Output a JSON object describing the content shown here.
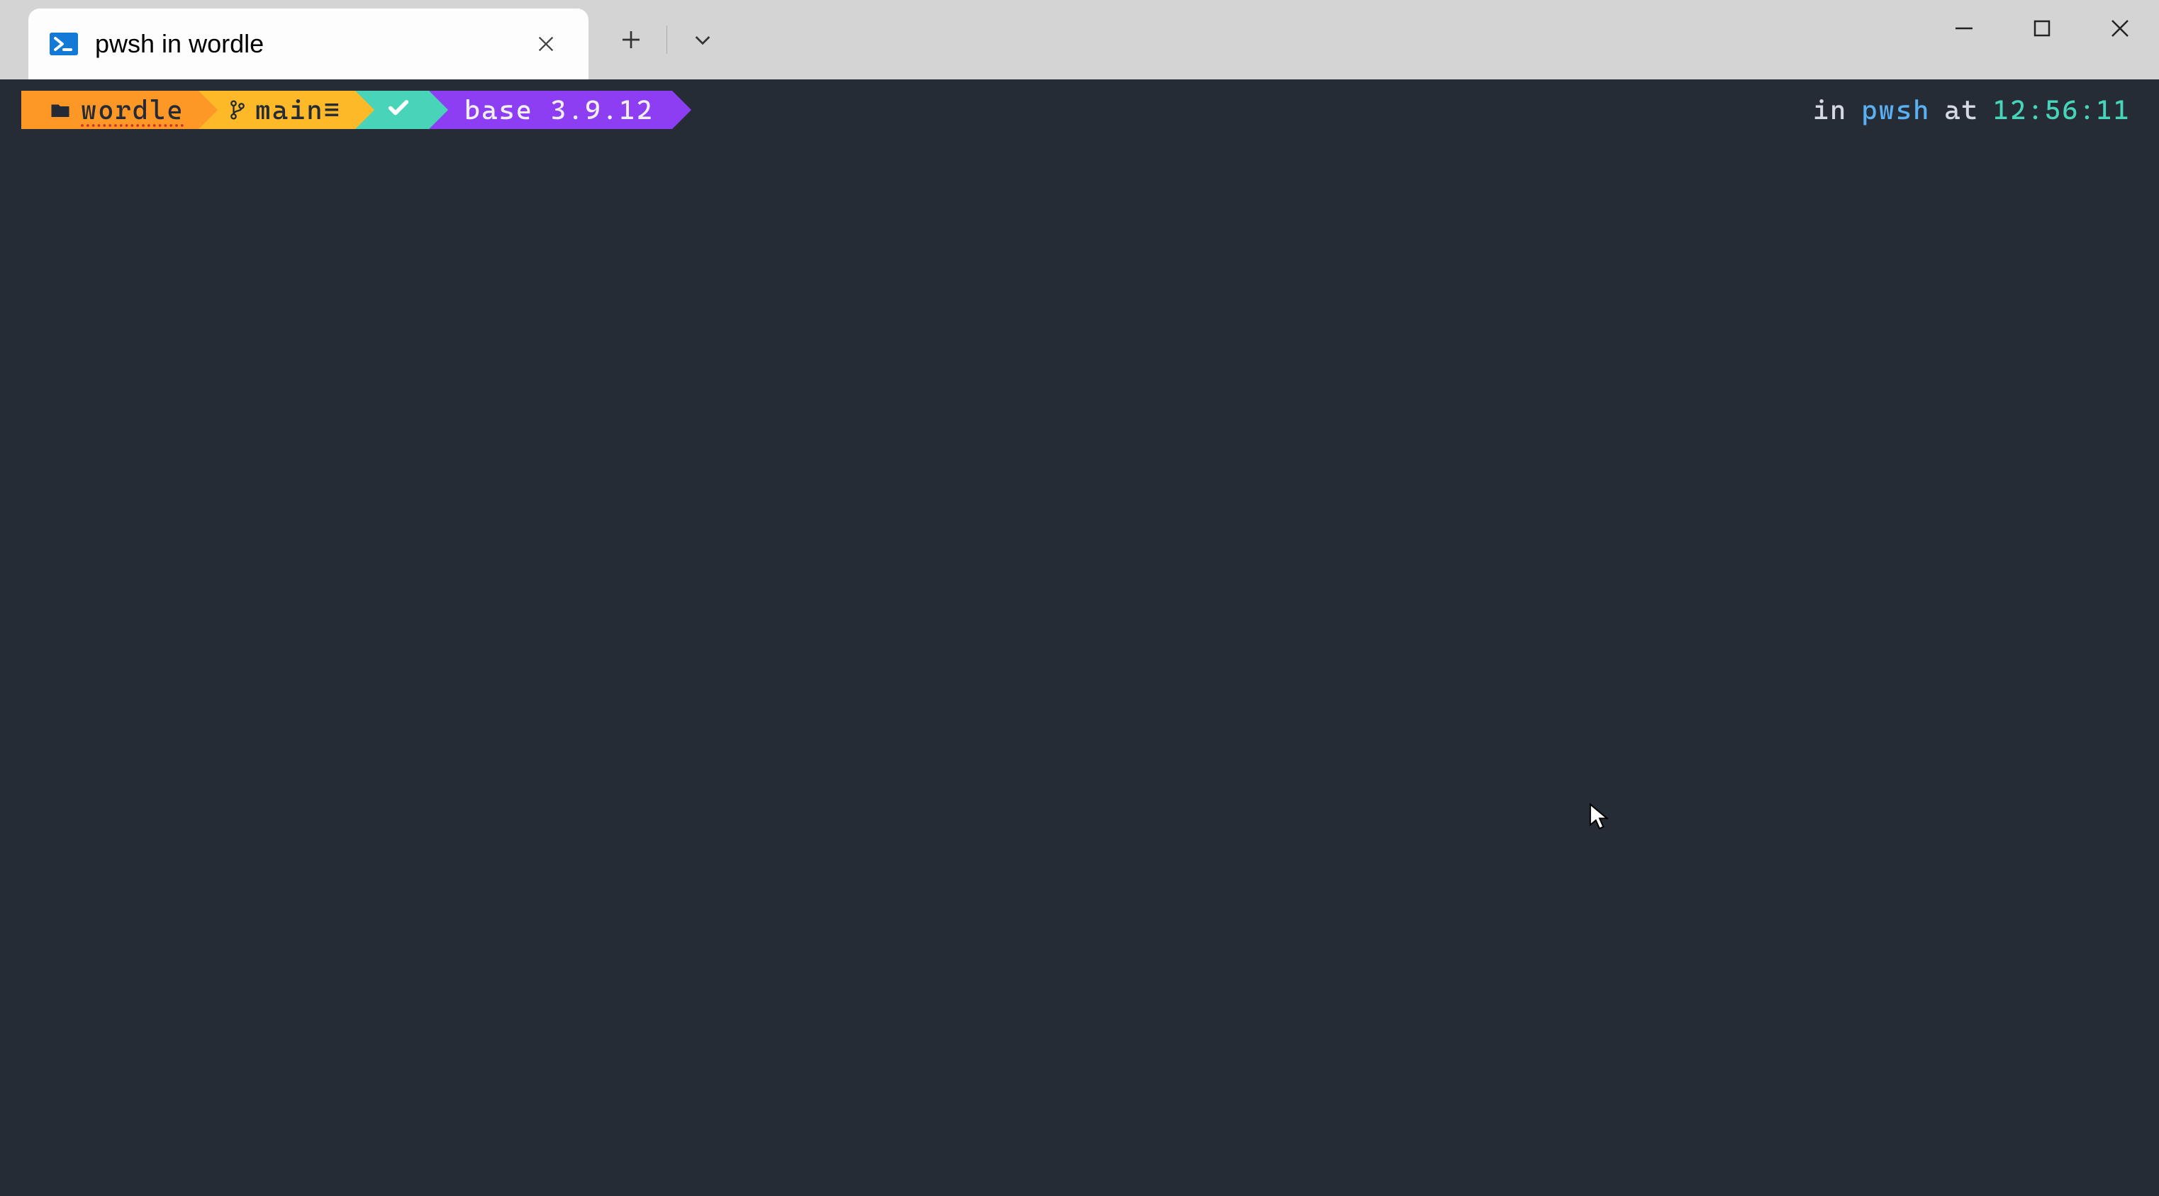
{
  "titlebar": {
    "tab_title": "pwsh in wordle"
  },
  "prompt": {
    "cwd": "wordle",
    "git_branch": "main≡",
    "env": "base 3.9.12",
    "check_icon": "check-icon"
  },
  "right_info": {
    "in_label": "in",
    "shell": "pwsh",
    "at_label": "at",
    "time": "12:56:11"
  },
  "colors": {
    "terminal_bg": "#262c36",
    "segment_orange": "#fd9726",
    "segment_yellow": "#fdb927",
    "segment_teal": "#47d4b9",
    "segment_purple": "#8d3ef2",
    "shell_blue": "#5ab0f2",
    "time_teal": "#47d4b9"
  }
}
